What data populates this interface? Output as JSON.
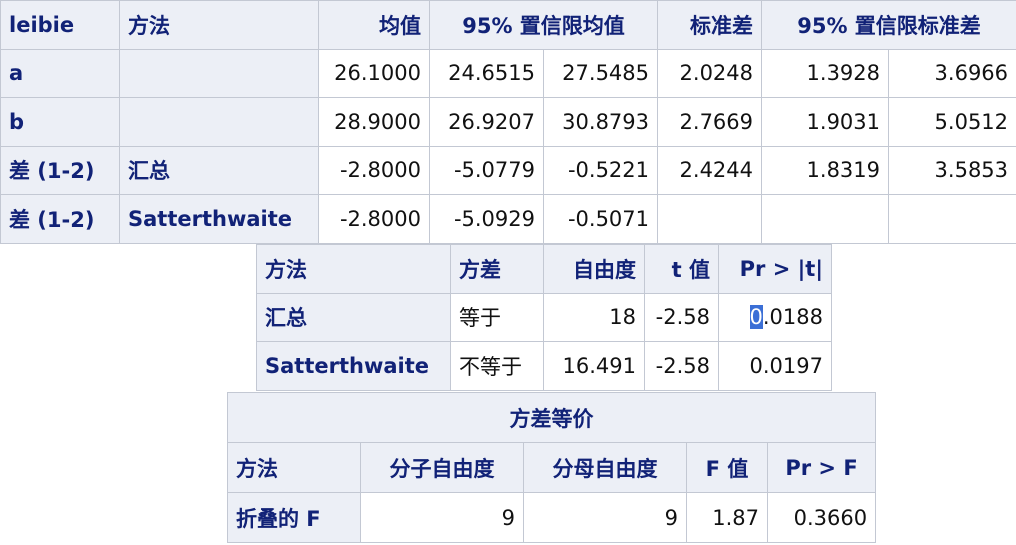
{
  "stats_table": {
    "headers": [
      "leibie",
      "方法",
      "均值",
      "95% 置信限均值",
      "标准差",
      "95% 置信限标准差"
    ],
    "rows": [
      {
        "leibie": "a",
        "method": "",
        "mean": "26.1000",
        "mean_lcl": "24.6515",
        "mean_ucl": "27.5485",
        "std": "2.0248",
        "std_lcl": "1.3928",
        "std_ucl": "3.6966"
      },
      {
        "leibie": "b",
        "method": "",
        "mean": "28.9000",
        "mean_lcl": "26.9207",
        "mean_ucl": "30.8793",
        "std": "2.7669",
        "std_lcl": "1.9031",
        "std_ucl": "5.0512"
      },
      {
        "leibie": "差 (1-2)",
        "method": "汇总",
        "mean": "-2.8000",
        "mean_lcl": "-5.0779",
        "mean_ucl": "-0.5221",
        "std": "2.4244",
        "std_lcl": "1.8319",
        "std_ucl": "3.5853"
      },
      {
        "leibie": "差 (1-2)",
        "method": "Satterthwaite",
        "mean": "-2.8000",
        "mean_lcl": "-5.0929",
        "mean_ucl": "-0.5071",
        "std": "",
        "std_lcl": "",
        "std_ucl": ""
      }
    ]
  },
  "ttest_table": {
    "headers": [
      "方法",
      "方差",
      "自由度",
      "t 值",
      "Pr > |t|"
    ],
    "rows": [
      {
        "method": "汇总",
        "variance": "等于",
        "df": "18",
        "t": "-2.58",
        "p_first": "0",
        "p_rest": ".0188"
      },
      {
        "method": "Satterthwaite",
        "variance": "不等于",
        "df": "16.491",
        "t": "-2.58",
        "p": "0.0197"
      }
    ]
  },
  "equality_table": {
    "title": "方差等价",
    "headers": [
      "方法",
      "分子自由度",
      "分母自由度",
      "F 值",
      "Pr > F"
    ],
    "rows": [
      {
        "method": "折叠的 F",
        "num_df": "9",
        "den_df": "9",
        "f": "1.87",
        "p": "0.3660"
      }
    ]
  }
}
